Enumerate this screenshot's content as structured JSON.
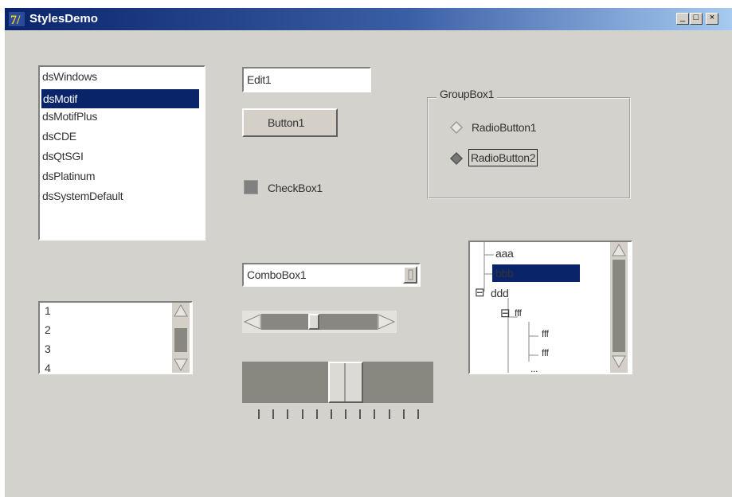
{
  "window": {
    "title": "StylesDemo",
    "minimize_label": "_",
    "maximize_label": "□",
    "close_label": "×"
  },
  "styles_list": {
    "items": [
      "dsWindows",
      "dsMotif",
      "dsMotifPlus",
      "dsCDE",
      "dsQtSGI",
      "dsPlatinum",
      "dsSystemDefault"
    ],
    "selected": "dsMotif"
  },
  "number_list": {
    "items": [
      "1",
      "2",
      "3",
      "4"
    ]
  },
  "edit": {
    "value": "Edit1"
  },
  "button": {
    "label": "Button1"
  },
  "checkbox": {
    "label": "CheckBox1",
    "checked": true
  },
  "groupbox": {
    "title": "GroupBox1",
    "radio1": "RadioButton1",
    "radio2": "RadioButton2",
    "selected": "RadioButton2"
  },
  "combobox": {
    "value": "ComboBox1"
  },
  "scrollbar": {
    "position_fraction": 0.45
  },
  "trackbar": {
    "position_fraction": 0.55,
    "tick_count": 12
  },
  "tree": {
    "items": [
      "aaa",
      "bbb",
      "ddd",
      "fff",
      "fff",
      "fff",
      "..."
    ],
    "selected": "bbb",
    "expanded_glyph": "⊟"
  },
  "colors": {
    "selection": "#0a246a",
    "face": "#d4d2cc",
    "title_gradient_start": "#0a246a"
  }
}
